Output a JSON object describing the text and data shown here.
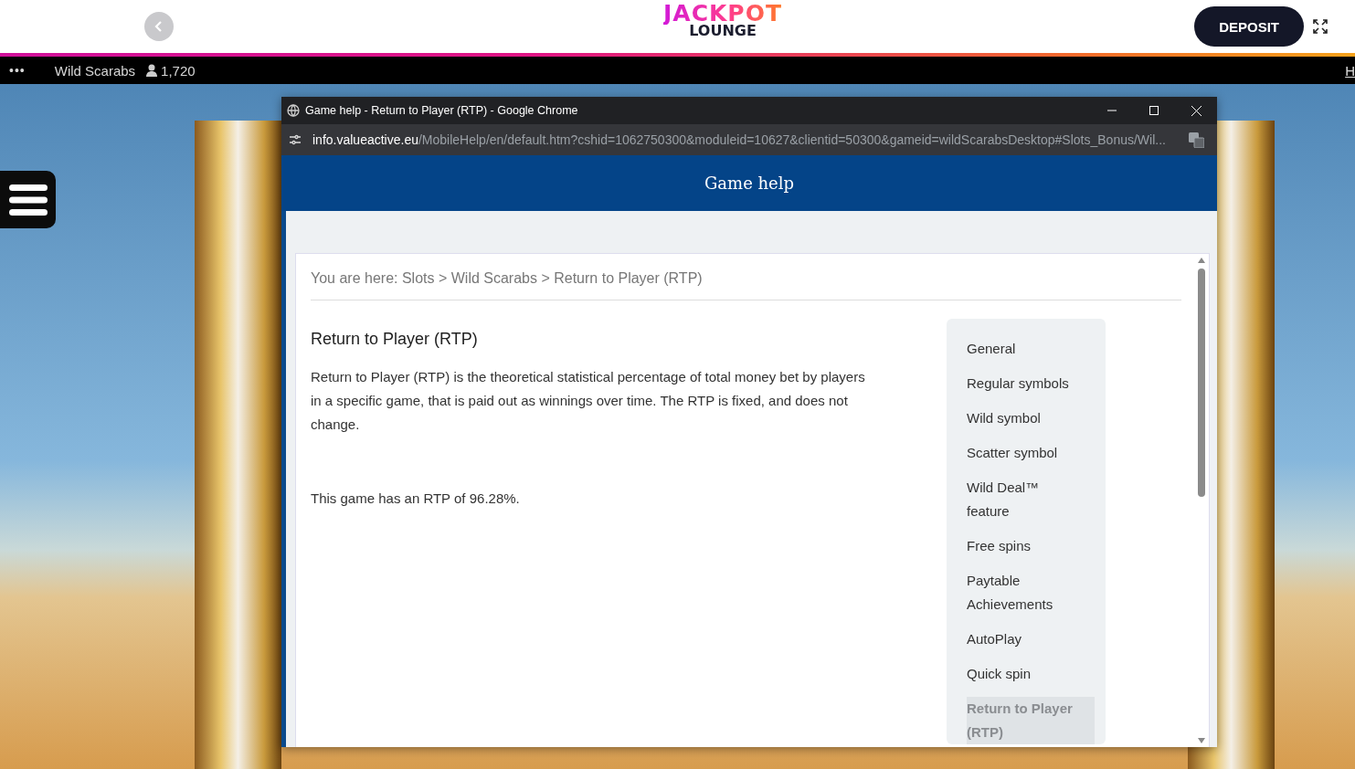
{
  "site_header": {
    "logo_top": "JACKPOT",
    "logo_bottom": "LOUNGE",
    "deposit_button": "DEPOSIT"
  },
  "game_bar": {
    "more": "•••",
    "game_title": "Wild Scarabs",
    "players": "1,720",
    "edge_link": "H"
  },
  "browser_window": {
    "title": "Game help - Return to Player (RTP) - Google Chrome",
    "url_host": "info.valueactive.eu",
    "url_path": "/MobileHelp/en/default.htm?cshid=1062750300&moduleid=10627&clientid=50300&gameid=wildScarabsDesktop#Slots_Bonus/Wil..."
  },
  "help_page": {
    "header": "Game help",
    "breadcrumb": "You are here: Slots > Wild Scarabs > Return to Player (RTP)",
    "heading": "Return to Player (RTP)",
    "paragraphs": [
      "Return to Player (RTP) is the theoretical statistical percentage of total money bet by players in a specific game, that is paid out as winnings over time. The RTP is fixed, and does not change.",
      "This game has an RTP of 96.28%."
    ],
    "nav": [
      {
        "label": "General",
        "selected": false
      },
      {
        "label": "Regular symbols",
        "selected": false
      },
      {
        "label": "Wild symbol",
        "selected": false
      },
      {
        "label": "Scatter symbol",
        "selected": false
      },
      {
        "label": "Wild Deal™ feature",
        "selected": false
      },
      {
        "label": "Free spins",
        "selected": false
      },
      {
        "label": "Paytable Achievements",
        "selected": false
      },
      {
        "label": "AutoPlay",
        "selected": false
      },
      {
        "label": "Quick spin",
        "selected": false
      },
      {
        "label": "Return to Player (RTP)",
        "selected": true
      }
    ]
  }
}
